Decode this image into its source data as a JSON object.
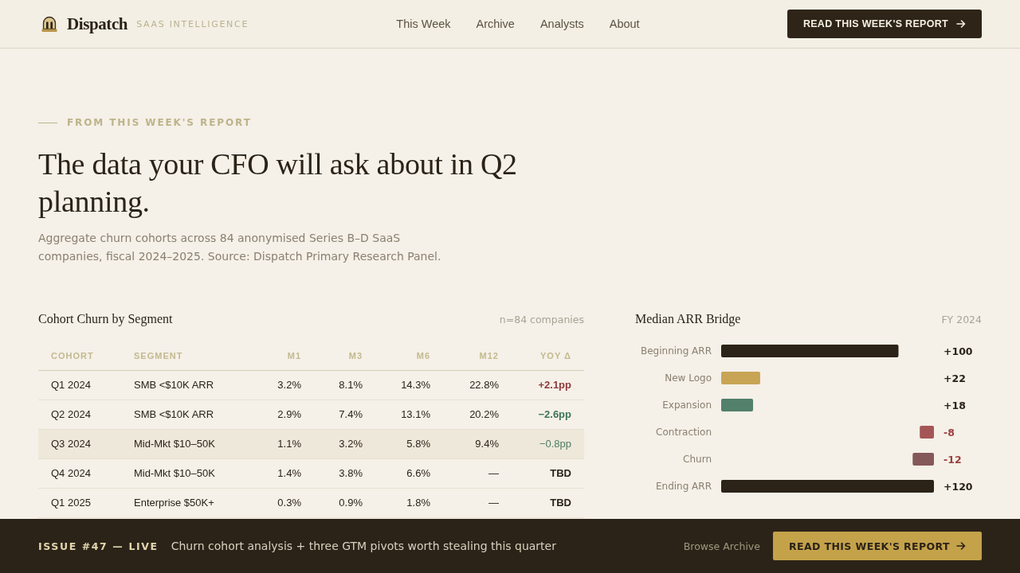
{
  "header": {
    "brand": "Dispatch",
    "tagline": "SAAS INTELLIGENCE",
    "nav": [
      "This Week",
      "Archive",
      "Analysts",
      "About"
    ],
    "cta": "READ THIS WEEK'S REPORT"
  },
  "hero": {
    "eyebrow": "FROM THIS WEEK'S REPORT",
    "headline": "The data your CFO will ask about in Q2 planning.",
    "summary": "Aggregate churn cohorts across 84 anonymised Series B–D SaaS companies, fiscal 2024–2025. Source: Dispatch Primary Research Panel."
  },
  "cohort_table": {
    "title": "Cohort Churn by Segment",
    "note": "n=84 companies",
    "columns": [
      "COHORT",
      "SEGMENT",
      "M1",
      "M3",
      "M6",
      "M12",
      "YOY Δ"
    ],
    "rows": [
      {
        "cells": [
          "Q1 2024",
          "SMB <$10K ARR",
          "3.2%",
          "8.1%",
          "14.3%",
          "22.8%"
        ],
        "yoy": "+2.1pp",
        "color": "#8e3b3b",
        "emphasized": true,
        "highlighted": false
      },
      {
        "cells": [
          "Q2 2024",
          "SMB <$10K ARR",
          "2.9%",
          "7.4%",
          "13.1%",
          "20.2%"
        ],
        "yoy": "−2.6pp",
        "color": "#3e7656",
        "emphasized": true,
        "highlighted": false
      },
      {
        "cells": [
          "Q3 2024",
          "Mid-Mkt $10–50K",
          "1.1%",
          "3.2%",
          "5.8%",
          "9.4%"
        ],
        "yoy": "−0.8pp",
        "color": "#4f7d60",
        "emphasized": false,
        "highlighted": true
      },
      {
        "cells": [
          "Q4 2024",
          "Mid-Mkt $10–50K",
          "1.4%",
          "3.8%",
          "6.6%",
          "—"
        ],
        "yoy": "TBD",
        "color": "#2b2318",
        "emphasized": true,
        "highlighted": false
      },
      {
        "cells": [
          "Q1 2025",
          "Enterprise $50K+",
          "0.3%",
          "0.9%",
          "1.8%",
          "—"
        ],
        "yoy": "TBD",
        "color": "#2b2318",
        "emphasized": true,
        "highlighted": false
      }
    ]
  },
  "arr_bridge": {
    "chart_data": {
      "type": "other",
      "title": "Median ARR Bridge",
      "subtitle": "FY 2024",
      "categories": [
        "Beginning ARR",
        "New Logo",
        "Expansion",
        "Contraction",
        "Churn",
        "Ending ARR"
      ],
      "values": [
        100,
        22,
        18,
        -8,
        -12,
        120
      ],
      "colors": [
        "#2b2318",
        "#c8a555",
        "#52806a",
        "#a45656",
        "#85585a",
        "#2b2318"
      ],
      "value_labels": [
        "+100",
        "+22",
        "+18",
        "-8",
        "-12",
        "+120"
      ]
    }
  },
  "bottom_bar": {
    "issue": "ISSUE #47 — LIVE",
    "headline": "Churn cohort analysis + three GTM pivots worth stealing this quarter",
    "link": "Browse Archive",
    "cta": "READ THIS WEEK'S REPORT"
  }
}
